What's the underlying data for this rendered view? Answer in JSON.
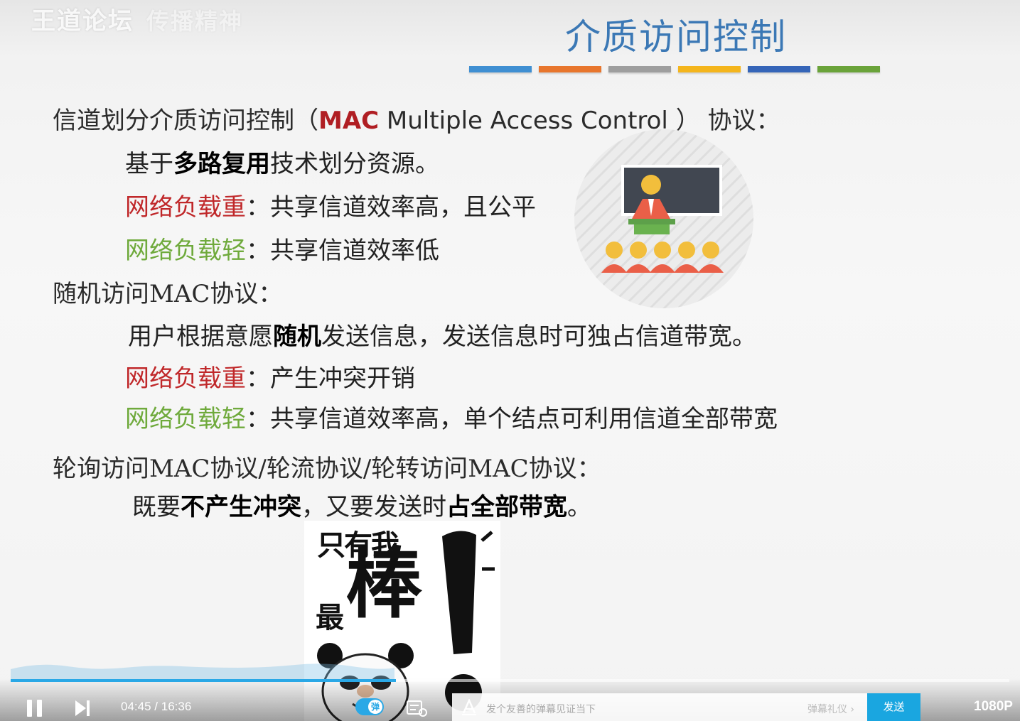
{
  "watermark": {
    "brand": "王道论坛",
    "extra": "传播精神"
  },
  "slide": {
    "title": "介质访问控制",
    "title_bar_colors": [
      "#3f8fd2",
      "#e8762d",
      "#9e9e9e",
      "#f4b51c",
      "#3565b8",
      "#6aa33a"
    ],
    "section1": {
      "heading_pre": "信道划分介质访问控制（",
      "heading_mac": "MAC",
      "heading_rest": " Multiple Access Control ）",
      "heading_post": "协议：",
      "line1_pre": "基于",
      "line1_bold": "多路复用",
      "line1_post": "技术划分资源。",
      "heavy_label": "网络负载重",
      "heavy_text": "：共享信道效率高，且公平",
      "light_label": "网络负载轻",
      "light_text": "：共享信道效率低"
    },
    "section2": {
      "heading": "随机访问MAC协议：",
      "line1_pre": "用户根据意愿",
      "line1_bold": "随机",
      "line1_post": "发送信息，发送信息时可独占信道带宽。",
      "heavy_label": "网络负载重",
      "heavy_text": "：产生冲突开销",
      "light_label": "网络负载轻",
      "light_text": "：共享信道效率高，单个结点可利用信道全部带宽"
    },
    "section3": {
      "heading": "轮询访问MAC协议/轮流协议/轮转访问MAC协议：",
      "line1_pre": "既要",
      "line1_bold1": "不产生冲突",
      "line1_mid": "，又要发送时",
      "line1_bold2": "占全部带宽",
      "line1_post": "。"
    },
    "meme": {
      "line1": "只有我",
      "big": "棒",
      "small": "最"
    }
  },
  "player": {
    "current_time": "04:45",
    "separator": "/",
    "total_time": "16:36",
    "progress_fraction": 0.386,
    "danmaku_toggle_label": "弹",
    "danmaku_placeholder": "发个友善的弹幕见证当下",
    "danmaku_etiquette": "弹幕礼仪 ›",
    "send_label": "发送",
    "quality": "1080P",
    "accent_color": "#2aa8e6"
  }
}
